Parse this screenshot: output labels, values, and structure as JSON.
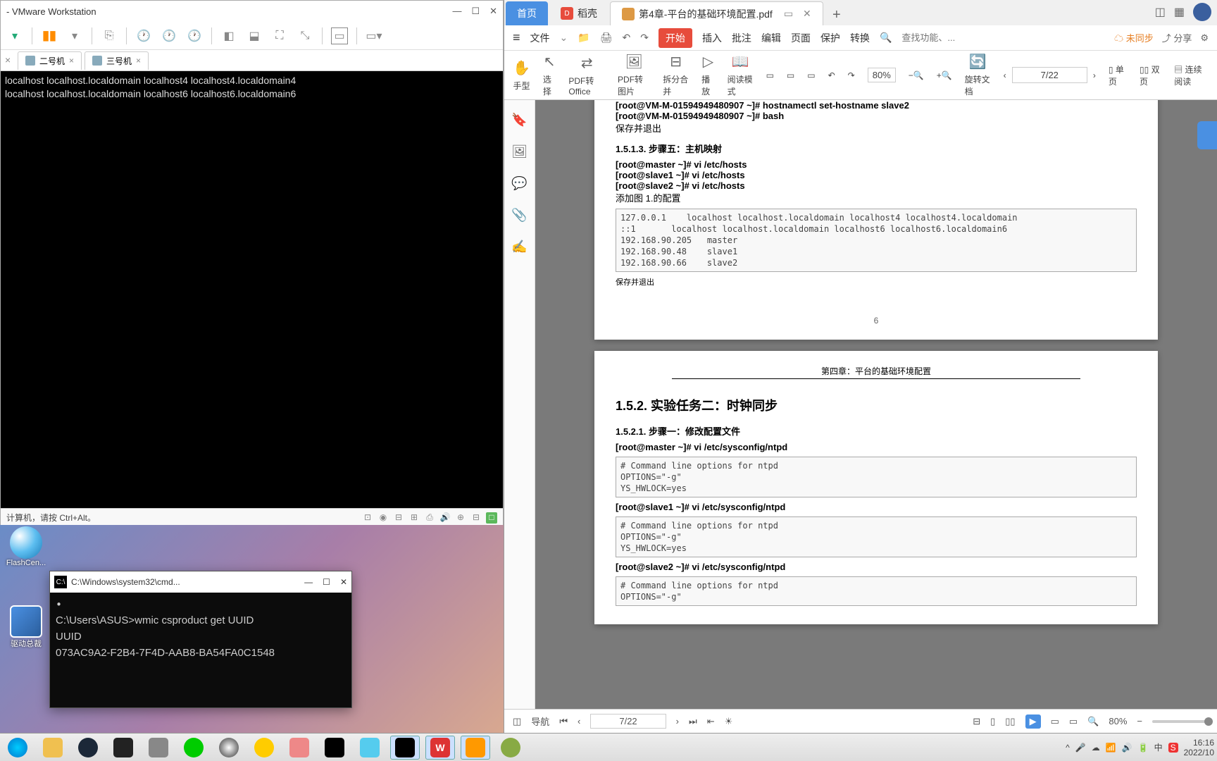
{
  "vmware": {
    "title": "- VMware Workstation",
    "tabs": {
      "t2": "二号机",
      "t3": "三号机"
    },
    "terminal_line1": "localhost localhost.localdomain localhost4 localhost4.localdomain4",
    "terminal_line2": "localhost localhost.localdomain localhost6 localhost6.localdomain6",
    "status_text": "计算机，请按 Ctrl+Alt。"
  },
  "desktop": {
    "flash": "FlashCen...",
    "driver": "驱动总裁"
  },
  "cmd": {
    "title": "C:\\Windows\\system32\\cmd...",
    "line1": "C:\\Users\\ASUS>wmic csproduct get UUID",
    "line2": "UUID",
    "line3": "073AC9A2-F2B4-7F4D-AAB8-BA54FA0C1548"
  },
  "wps": {
    "tabs": {
      "home": "首页",
      "daoke": "稻壳",
      "pdf": "第4章-平台的基础环境配置.pdf"
    },
    "menu": {
      "file": "文件",
      "start": "开始",
      "insert": "插入",
      "annotate": "批注",
      "edit": "编辑",
      "page": "页面",
      "protect": "保护",
      "convert": "转换",
      "search_ph": "查找功能、...",
      "sync": "未同步",
      "share": "分享"
    },
    "ribbon": {
      "hand": "手型",
      "select": "选择",
      "topdf": "PDF转Office",
      "toimg": "PDF转图片",
      "split": "拆分合并",
      "play": "播放",
      "reader": "阅读模式",
      "zoom": "80%",
      "rotate": "旋转文档",
      "single": "单页",
      "double": "双页",
      "continuous": "连续阅读",
      "page": "7/22"
    },
    "doc": {
      "cmd1": "[root@VM-M-01594949480907 ~]# hostnamectl set-hostname slave2",
      "cmd2": "[root@VM-M-01594949480907 ~]# bash",
      "save_exit": "保存并退出",
      "h513": "1.5.1.3.  步骤五：主机映射",
      "master_hosts": "[root@master ~]# vi /etc/hosts",
      "slave1_hosts": "[root@slave1 ~]# vi /etc/hosts",
      "slave2_hosts": "[root@slave2 ~]# vi /etc/hosts",
      "add_fig": "添加图 1.的配置",
      "hosts_block": "127.0.0.1    localhost localhost.localdomain localhost4 localhost4.localdomain\n::1       localhost localhost.localdomain localhost6 localhost6.localdomain6\n192.168.90.205   master\n192.168.90.48    slave1\n192.168.90.66    slave2",
      "save_exit2": "保存并退出",
      "pgnum6": "6",
      "chapter": "第四章：平台的基础环境配置",
      "h152": "1.5.2. 实验任务二：时钟同步",
      "h1521": "1.5.2.1.  步骤一：修改配置文件",
      "master_ntpd": "[root@master ~]# vi /etc/sysconfig/ntpd",
      "ntpd_block": "# Command line options for ntpd\nOPTIONS=\"-g\"\nYS_HWLOCK=yes",
      "slave1_ntpd": "[root@slave1 ~]# vi /etc/sysconfig/ntpd",
      "slave2_ntpd": "[root@slave2 ~]# vi /etc/sysconfig/ntpd",
      "ntpd_block3": "# Command line options for ntpd\nOPTIONS=\"-g\""
    },
    "footer": {
      "nav": "导航",
      "page": "7/22",
      "zoom": "80%"
    }
  },
  "taskbar": {
    "time": "16:16",
    "date": "2022/10"
  }
}
